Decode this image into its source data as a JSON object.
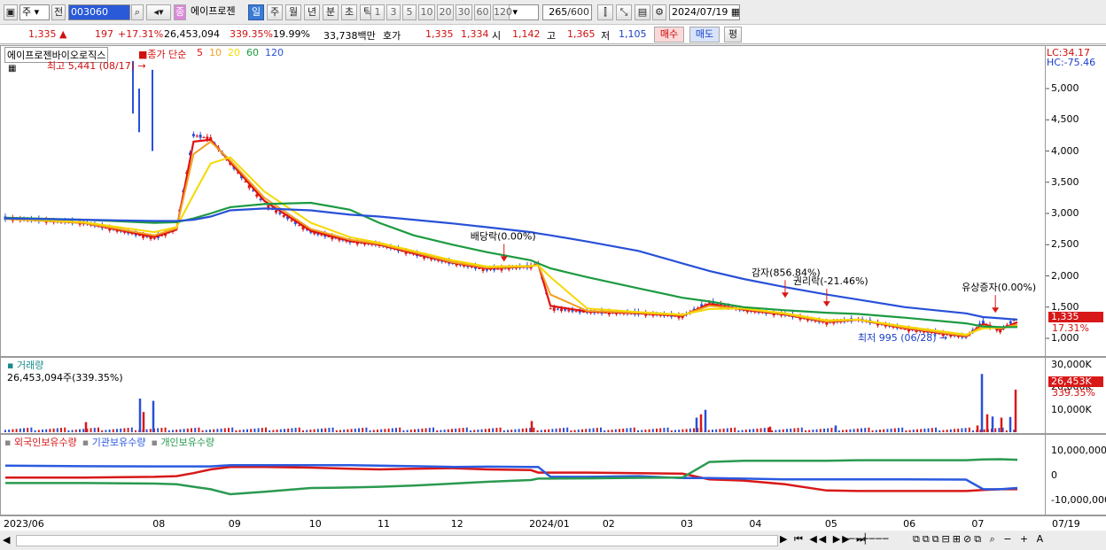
{
  "toolbar": {
    "market": "주",
    "prev_label": "전",
    "code": "003060",
    "stock_name": "에이프로젠",
    "periods": [
      "일",
      "주",
      "월",
      "년",
      "분",
      "초",
      "틱"
    ],
    "active_period": "일",
    "intervals": [
      "1",
      "3",
      "5",
      "10",
      "20",
      "30",
      "60",
      "120"
    ],
    "count": "265",
    "count_max": "/600",
    "date": "2024/07/19"
  },
  "quote": {
    "price": "1,335",
    "change": "197",
    "change_pct": "+17.31%",
    "volume": "26,453,094",
    "volume_ratio": "339.35%",
    "turnover": "19.99%",
    "amount": "33,738백만",
    "bid_label": "호가",
    "ask": "1,335",
    "bid": "1,334",
    "open_label": "시",
    "open": "1,142",
    "high_label": "고",
    "high": "1,365",
    "low_label": "저",
    "low": "1,105",
    "buy_button": "매수",
    "sell_button": "매도",
    "avg_button": "평"
  },
  "price_panel": {
    "name": "에이프로젠바이오로직스",
    "indicator": "종가 단순",
    "ma_periods": [
      "5",
      "10",
      "20",
      "60",
      "120"
    ],
    "ma_colors": [
      "#e01010",
      "#f0a020",
      "#f5d800",
      "#1c9a40",
      "#2850d8"
    ],
    "high_note": "최고 5,441 (08/17)",
    "low_note": "최저 995 (06/28)",
    "lc": "LC:34.17",
    "hc": "HC:-75.46",
    "last_tag": "1,335",
    "last_pct": "17.31%",
    "y_ticks": [
      "5,000",
      "4,500",
      "4,000",
      "3,500",
      "3,000",
      "2,500",
      "2,000",
      "1,500",
      "1,000"
    ],
    "events": [
      {
        "label": "배당락(0.00%)"
      },
      {
        "label": "감자(856.84%)"
      },
      {
        "label": "권리락(-21.46%)"
      },
      {
        "label": "유상증자(0.00%)"
      }
    ]
  },
  "volume_panel": {
    "title": "거래량",
    "value_text": "26,453,094주(339.35%)",
    "y_ticks": [
      "30,000K",
      "20,000K",
      "10,000K"
    ],
    "last_tag": "26,453K",
    "last_pct": "339.35%"
  },
  "holding_panel": {
    "legend": [
      "외국인보유수량",
      "기관보유수량",
      "개인보유수량"
    ],
    "colors": [
      "#d81818",
      "#2a5ae0",
      "#2a9a50"
    ],
    "y_ticks": [
      "10,000,000",
      "0",
      "-10,000,000"
    ]
  },
  "x_axis": [
    "2023/06",
    "08",
    "09",
    "10",
    "11",
    "12",
    "2024/01",
    "02",
    "03",
    "04",
    "05",
    "06",
    "07",
    "07/19"
  ],
  "chart_data": {
    "type": "line",
    "x": [
      "2023-06-01",
      "2023-07-03",
      "2023-08-01",
      "2023-08-10",
      "2023-08-17",
      "2023-08-24",
      "2023-09-01",
      "2023-09-15",
      "2023-10-04",
      "2023-10-20",
      "2023-11-01",
      "2023-11-15",
      "2023-12-01",
      "2023-12-15",
      "2024-01-02",
      "2024-01-05",
      "2024-01-10",
      "2024-01-25",
      "2024-02-15",
      "2024-03-04",
      "2024-03-15",
      "2024-03-29",
      "2024-04-15",
      "2024-05-02",
      "2024-05-15",
      "2024-06-03",
      "2024-06-28",
      "2024-07-05",
      "2024-07-12",
      "2024-07-19"
    ],
    "series": [
      {
        "name": "종가",
        "values": [
          2920,
          2850,
          2600,
          2750,
          4250,
          4200,
          3800,
          3150,
          2700,
          2550,
          2500,
          2350,
          2200,
          2100,
          2150,
          2200,
          1480,
          1420,
          1400,
          1350,
          1580,
          1450,
          1380,
          1250,
          1300,
          1150,
          1020,
          1250,
          1120,
          1335
        ]
      },
      {
        "name": "5",
        "values": [
          2920,
          2850,
          2620,
          2740,
          4150,
          4180,
          3820,
          3200,
          2720,
          2560,
          2500,
          2360,
          2210,
          2120,
          2150,
          2190,
          1520,
          1430,
          1400,
          1360,
          1550,
          1460,
          1380,
          1260,
          1300,
          1160,
          1030,
          1230,
          1140,
          1260
        ]
      },
      {
        "name": "10",
        "values": [
          2910,
          2850,
          2650,
          2760,
          3950,
          4150,
          3850,
          3250,
          2750,
          2580,
          2510,
          2380,
          2220,
          2130,
          2150,
          2180,
          1700,
          1440,
          1410,
          1370,
          1520,
          1470,
          1390,
          1270,
          1300,
          1170,
          1040,
          1200,
          1160,
          1220
        ]
      },
      {
        "name": "20",
        "values": [
          2920,
          2860,
          2700,
          2780,
          3300,
          3800,
          3900,
          3350,
          2850,
          2620,
          2530,
          2400,
          2250,
          2150,
          2160,
          2170,
          1980,
          1480,
          1420,
          1380,
          1470,
          1480,
          1400,
          1290,
          1300,
          1190,
          1060,
          1160,
          1170,
          1190
        ]
      },
      {
        "name": "60",
        "values": [
          2930,
          2900,
          2850,
          2860,
          2920,
          3000,
          3100,
          3150,
          3170,
          3060,
          2850,
          2650,
          2500,
          2380,
          2250,
          2200,
          2120,
          1980,
          1800,
          1650,
          1590,
          1500,
          1450,
          1410,
          1390,
          1330,
          1240,
          1190,
          1180,
          1180
        ]
      },
      {
        "name": "120",
        "values": [
          2920,
          2900,
          2880,
          2880,
          2900,
          2950,
          3050,
          3080,
          3050,
          2980,
          2950,
          2900,
          2840,
          2780,
          2700,
          2680,
          2650,
          2550,
          2400,
          2200,
          2080,
          1950,
          1820,
          1700,
          1620,
          1500,
          1400,
          1340,
          1320,
          1300
        ]
      }
    ],
    "ylim": [
      900,
      5441
    ],
    "volume": {
      "x_last": "2024-07-19",
      "last": 26453094
    },
    "holding": {
      "series": [
        {
          "name": "외국인보유수량",
          "values": [
            -800000,
            -800000,
            -500000,
            -200000,
            1000000,
            2500000,
            3500000,
            3500000,
            3200000,
            2800000,
            2500000,
            2800000,
            3000000,
            2500000,
            2200000,
            1200000,
            1200000,
            1200000,
            1000000,
            800000,
            -1500000,
            -2000000,
            -3500000,
            -6000000,
            -6200000,
            -6200000,
            -6200000,
            -5800000,
            -5500000,
            -5500000
          ]
        },
        {
          "name": "기관보유수량",
          "values": [
            4000000,
            3800000,
            3700000,
            3700000,
            3700000,
            3700000,
            4200000,
            4200000,
            4200000,
            4200000,
            4000000,
            3800000,
            3500000,
            3600000,
            3500000,
            3500000,
            -500000,
            -500000,
            -200000,
            -1000000,
            -1000000,
            -1200000,
            -1500000,
            -1500000,
            -1500000,
            -1500000,
            -1600000,
            -5500000,
            -5500000,
            -5000000
          ]
        },
        {
          "name": "개인보유수량",
          "values": [
            -3000000,
            -3000000,
            -3200000,
            -3500000,
            -4500000,
            -5500000,
            -7500000,
            -6500000,
            -5000000,
            -4800000,
            -4500000,
            -4000000,
            -3200000,
            -2500000,
            -1800000,
            -1200000,
            -1200000,
            -1100000,
            -900000,
            -800000,
            5500000,
            6000000,
            6000000,
            6000000,
            6200000,
            6200000,
            6200000,
            6500000,
            6600000,
            6400000
          ]
        }
      ]
    }
  }
}
